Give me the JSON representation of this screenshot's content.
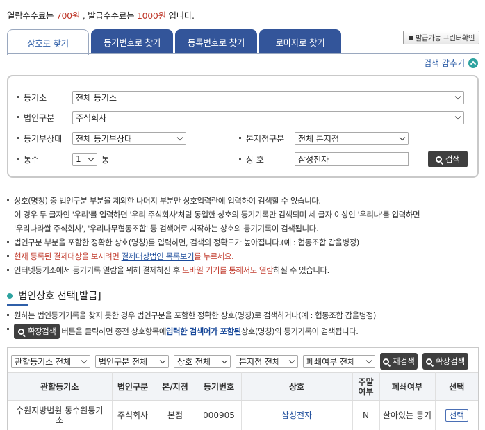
{
  "fee": {
    "prefix": "열람수수료는 ",
    "view_fee": "700원",
    "mid": " , 발급수수료는 ",
    "issue_fee": "1000원",
    "suffix": " 입니다."
  },
  "tabs": [
    {
      "label": "상호로 찾기"
    },
    {
      "label": "등기번호로 찾기"
    },
    {
      "label": "등록번호로 찾기"
    },
    {
      "label": "로마자로 찾기"
    }
  ],
  "print_button": "발급가능 프린터확인",
  "hide_search": "검색 감추기",
  "search": {
    "registry_label": "등기소",
    "registry_value": "전체 등기소",
    "corp_type_label": "법인구분",
    "corp_type_value": "주식회사",
    "reg_status_label": "등기부상태",
    "reg_status_value": "전체 등기부상태",
    "branch_label": "본지점구분",
    "branch_value": "전체 본지점",
    "count_label": "통수",
    "count_value": "1",
    "count_unit": "통",
    "name_label": "상 호",
    "name_value": "삼성전자",
    "search_button": "검색"
  },
  "notes": {
    "n1": "상호(명칭) 중 법인구분 부분을 제외한 나머지 부분만 상호입력란에 입력하여 검색할 수 있습니다.",
    "n1b": "이 경우 두 글자인 '우리'를 입력하면 '우리 주식회사'처럼 동일한 상호의 등기기록만 검색되며 세 글자 이상인 '우리나'를 입력하면",
    "n1c": "'우리나라쌀 주식회사', '우리나무협동조합' 등 검색어로 시작하는 상호의 등기기록이 검색됩니다.",
    "n2": "법인구분 부분을 포함한 정확한 상호(명칭)를 입력하면, 검색의 정확도가 높아집니다.(예 : 협동조합 갑을병정)",
    "n3a": "현재 등록된 결제대상을 보시려면 ",
    "n3link": "결제대상법인 목록보기",
    "n3b": "를 누르세요.",
    "n4a": "인터넷등기소에서 등기기록 열람을 위해 결제하신 후 ",
    "n4red": "모바일 기기를 통해서도 열람",
    "n4b": "하실 수 있습니다."
  },
  "section_title": "법인상호 선택[발급]",
  "notes2": {
    "m1": "원하는 법인등기기록을 찾지 못한 경우 법인구분을 포함한 정확한 상호(명칭)로 검색하거나(예 : 협동조합 갑을병정)",
    "expand_button": "확장검색",
    "m2a": " 버튼을 클릭하면 종전 상호항목에 ",
    "m2bold": "입력한 검색어가 포함된",
    "m2b": " 상호(명칭)의 등기기록이 검색됩니다."
  },
  "filters": {
    "registry": "관할등기소 전체",
    "corp_type": "법인구분 전체",
    "name": "상호 전체",
    "branch": "본지점 전체",
    "closed": "폐쇄여부 전체",
    "research_button": "재검색",
    "expand_button": "확장검색"
  },
  "table": {
    "headers": [
      "관할등기소",
      "법인구분",
      "본/지점",
      "등기번호",
      "상호",
      "주말여부",
      "폐쇄여부",
      "선택"
    ],
    "rows": [
      {
        "registry": "수원지방법원 동수원등기소",
        "corp_type": "주식회사",
        "branch": "본점",
        "reg_no": "000905",
        "name": "삼성전자",
        "weekend": "N",
        "closed": "살아있는 등기",
        "select": "선택"
      }
    ]
  }
}
